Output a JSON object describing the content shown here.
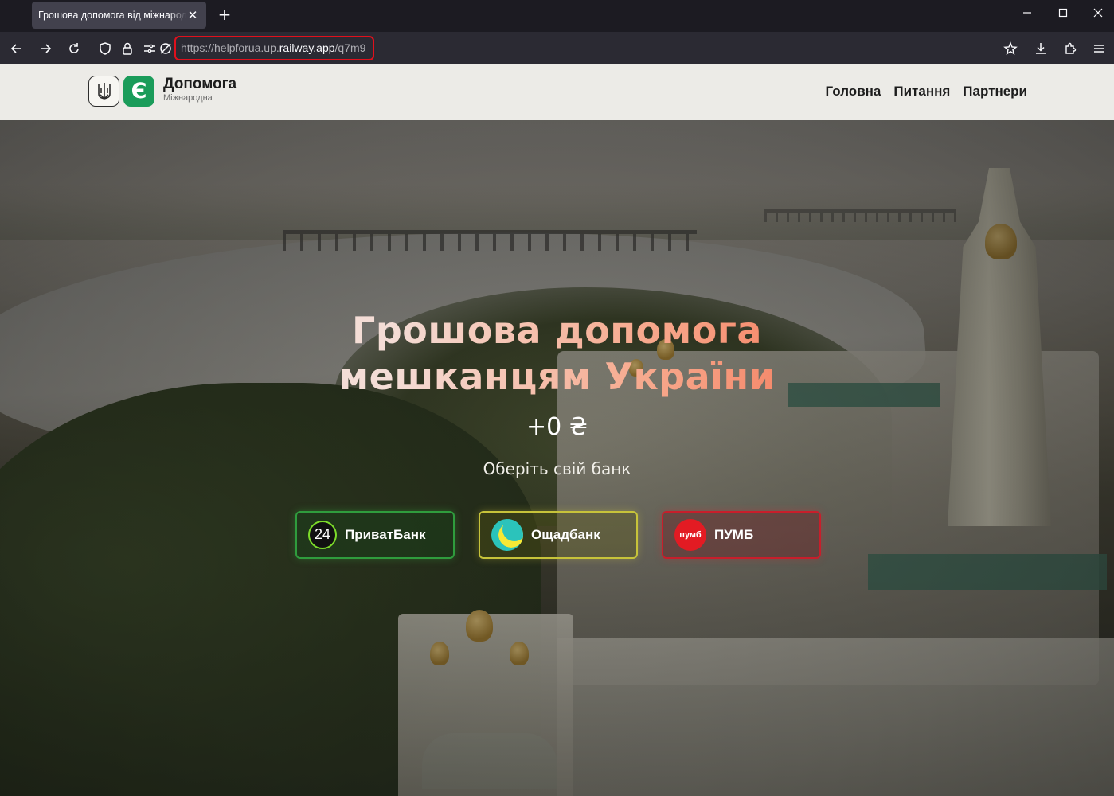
{
  "browser": {
    "tab_title": "Грошова допомога від міжнародн",
    "tab_close": "✕",
    "new_tab": "+",
    "url_prefix": "https://helpforua.up.",
    "url_host": "railway.app",
    "url_path": "/q7m9"
  },
  "site": {
    "logo_title": "Допомога",
    "logo_subtitle": "Міжнародна",
    "logo_letter": "Є",
    "menu": [
      "Головна",
      "Питання",
      "Партнери"
    ]
  },
  "hero": {
    "title_line1": "Грошова допомога",
    "title_line2": "мешканцям України",
    "amount": "+0 ₴",
    "choose_bank": "Оберіть свій банк"
  },
  "banks": [
    {
      "label": "ПриватБанк",
      "icon": "privat-24-icon",
      "icon_text": "24",
      "accent": "#2f9c3d"
    },
    {
      "label": "Ощадбанк",
      "icon": "oschad-moon-icon",
      "accent": "#c7c33a"
    },
    {
      "label": "ПУМБ",
      "icon": "pumb-icon",
      "icon_text": "пумб",
      "accent": "#c81e2b"
    }
  ],
  "colors": {
    "brand_green": "#1a9c5a",
    "url_highlight": "#e0101c",
    "title_gradient_end": "#f58a6c"
  }
}
